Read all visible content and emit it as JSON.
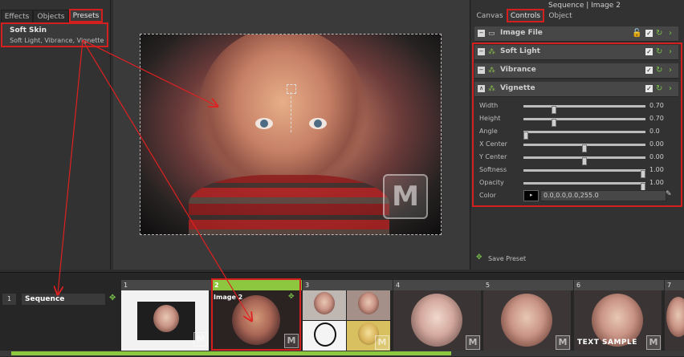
{
  "left_panel": {
    "tabs": [
      {
        "label": "Effects"
      },
      {
        "label": "Objects"
      },
      {
        "label": "Presets",
        "active": true
      }
    ],
    "preset": {
      "title": "Soft Skin",
      "desc": "Soft Light, Vibrance, Vignette"
    }
  },
  "window_title": "Sequence | Image 2",
  "right_panel": {
    "tabs": [
      {
        "label": "Canvas"
      },
      {
        "label": "Controls",
        "active": true
      },
      {
        "label": "Object"
      }
    ],
    "image_file": "Image File",
    "effects": [
      {
        "label": "Soft Light"
      },
      {
        "label": "Vibrance"
      },
      {
        "label": "Vignette"
      }
    ],
    "params": [
      {
        "label": "Width",
        "value": "0.70",
        "level": 0.24
      },
      {
        "label": "Height",
        "value": "0.70",
        "level": 0.24
      },
      {
        "label": "Angle",
        "value": "0.0",
        "level": 0.0
      },
      {
        "label": "X Center",
        "value": "0.00",
        "level": 0.5
      },
      {
        "label": "Y Center",
        "value": "0.00",
        "level": 0.5
      },
      {
        "label": "Softness",
        "value": "1.00",
        "level": 1.0
      },
      {
        "label": "Opacity",
        "value": "1.00",
        "level": 1.0
      }
    ],
    "color": {
      "label": "Color",
      "value": "0.0,0.0,0.0,255.0"
    },
    "save_preset": "Save Preset"
  },
  "filmstrip": {
    "sequence_index": "1",
    "sequence_name": "Sequence",
    "frames": [
      {
        "num": "1"
      },
      {
        "num": "2",
        "title": "Image 2",
        "selected": true
      },
      {
        "num": "3"
      },
      {
        "num": "4"
      },
      {
        "num": "5"
      },
      {
        "num": "6",
        "caption": "TEXT SAMPLE"
      },
      {
        "num": "7"
      }
    ]
  },
  "watermark": "M",
  "colors": {
    "accent_red": "#d41f1f",
    "accent_green": "#8dc63f",
    "panel": "#323232"
  }
}
